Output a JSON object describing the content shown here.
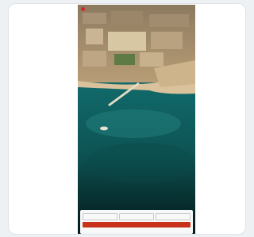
{
  "site": {
    "brand": "",
    "eyebrow": "",
    "hotel_name": "",
    "location": "",
    "tagline": ""
  },
  "booking": {
    "title": "",
    "fields": [
      {
        "label": "",
        "value": ""
      },
      {
        "label": "",
        "value": ""
      },
      {
        "label": "",
        "value": ""
      }
    ],
    "cta": ""
  },
  "colors": {
    "accent": "#c8321a",
    "brand_dot": "#d6242a",
    "sea": "#0f5f63",
    "sand": "#caa77c"
  }
}
